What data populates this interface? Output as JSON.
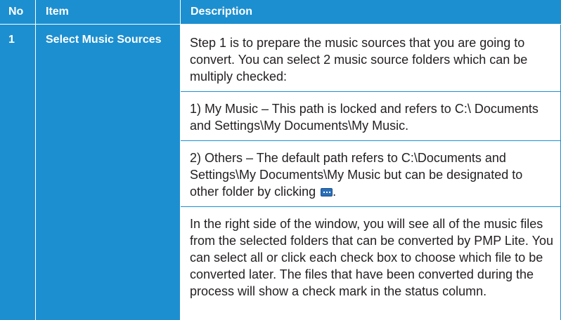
{
  "table": {
    "header": {
      "no": "No",
      "item": "Item",
      "description": "Description"
    },
    "row": {
      "no": "1",
      "item": "Select Music Sources",
      "paragraphs": [
        "Step 1 is to prepare the music sources that you are going to convert. You can select 2 music source folders which can be multiply checked:",
        "1) My Music – This path is locked and refers to C:\\ Documents and Settings\\My Documents\\My Music.",
        "2) Others – The default path refers to C:\\Documents and Settings\\My Documents\\My Music but can be designated to other folder by clicking",
        "In the right side of the window, you will see all of the music files from the selected folders that can be converted by PMP Lite. You can select all or click each check box to choose which file to be converted later. The files that have been converted during the process will show a check mark in the status column."
      ],
      "paragraph3_end": ".",
      "browse_icon": "browse-ellipsis-icon"
    }
  },
  "colors": {
    "accent": "#1c8fd0",
    "text": "#231f20",
    "background": "#ffffff"
  }
}
